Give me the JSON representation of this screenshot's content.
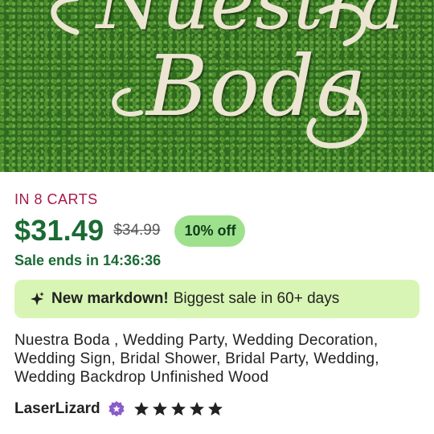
{
  "hero": {
    "sign_text_line1": "Nuestra",
    "sign_text_line2": "Boda"
  },
  "listing": {
    "carts_text": "IN 8 CARTS",
    "price": "$31.49",
    "original_price": "$34.99",
    "discount_badge": "10% off",
    "sale_ends_text": "Sale ends in 14:36:36",
    "markdown": {
      "icon": "sparkle-icon",
      "bold_text": "New markdown!",
      "text": "Biggest sale in 60+ days"
    },
    "title": "Nuestra Boda , Wedding Party, Wedding Decoration, Wedding Sign, Bridal Shower, Bridal Party, Wedding, Wedding Backdrop Unfinished Wood",
    "shop": {
      "name": "LaserLizard",
      "badge_icon": "star-seller-badge-icon",
      "rating": 5,
      "max_rating": 5
    }
  },
  "colors": {
    "price_green": "#1b6b34",
    "carts_red": "#a61a4b",
    "discount_bg": "#9ee18d",
    "markdown_bg": "#d9f5b5",
    "badge_purple": "#8a5cc9"
  }
}
